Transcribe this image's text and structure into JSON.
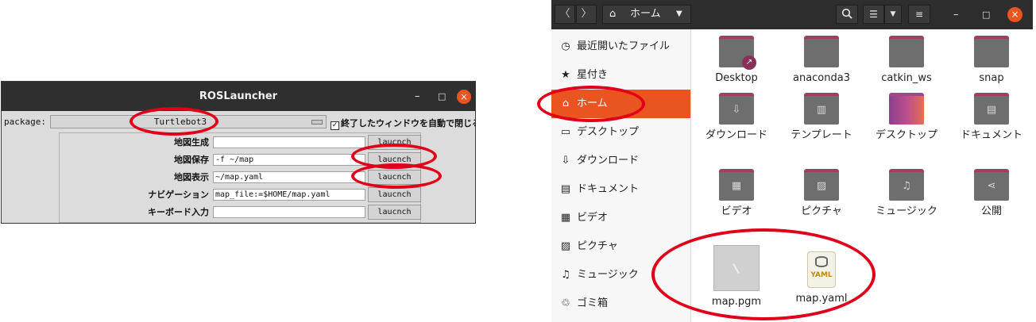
{
  "ros_launcher": {
    "title": "ROSLauncher",
    "minimize": "–",
    "maximize": "□",
    "close": "×",
    "package_label": "package:",
    "package_value": "Turtlebot3",
    "checkbox_mark": "✓",
    "checkbox_label": "終了したウィンドウを自動で閉じる",
    "rows": [
      {
        "label": "地図生成",
        "value": "",
        "button": "laucnch"
      },
      {
        "label": "地図保存",
        "value": "-f ~/map",
        "button": "laucnch"
      },
      {
        "label": "地図表示",
        "value": "~/map.yaml",
        "button": "laucnch"
      },
      {
        "label": "ナビゲーション",
        "value": "map_file:=$HOME/map.yaml",
        "button": "laucnch"
      },
      {
        "label": "キーボード入力",
        "value": "",
        "button": "laucnch"
      }
    ]
  },
  "file_manager": {
    "back": "〈",
    "forward": "〉",
    "location": "ホーム",
    "search_icon": "search-icon",
    "close": "×",
    "minimize": "–",
    "maximize": "□",
    "sidebar": [
      {
        "icon": "recent-icon",
        "glyph": "◷",
        "label": "最近開いたファイル"
      },
      {
        "icon": "star-icon",
        "glyph": "★",
        "label": "星付き"
      },
      {
        "icon": "home-icon",
        "glyph": "⌂",
        "label": "ホーム"
      },
      {
        "icon": "desktop-icon",
        "glyph": "▭",
        "label": "デスクトップ"
      },
      {
        "icon": "download-icon",
        "glyph": "⇩",
        "label": "ダウンロード"
      },
      {
        "icon": "document-icon",
        "glyph": "▤",
        "label": "ドキュメント"
      },
      {
        "icon": "video-icon",
        "glyph": "▦",
        "label": "ビデオ"
      },
      {
        "icon": "picture-icon",
        "glyph": "▨",
        "label": "ピクチャ"
      },
      {
        "icon": "music-icon",
        "glyph": "♫",
        "label": "ミュージック"
      },
      {
        "icon": "trash-icon",
        "glyph": "♲",
        "label": "ゴミ箱"
      }
    ],
    "files": [
      {
        "name": "Desktop",
        "type": "folder",
        "emblem": "",
        "badge": "↗"
      },
      {
        "name": "anaconda3",
        "type": "folder",
        "emblem": ""
      },
      {
        "name": "catkin_ws",
        "type": "folder",
        "emblem": ""
      },
      {
        "name": "snap",
        "type": "folder",
        "emblem": ""
      },
      {
        "name": "ダウンロード",
        "type": "folder",
        "emblem": "⇩"
      },
      {
        "name": "テンプレート",
        "type": "folder",
        "emblem": "▥"
      },
      {
        "name": "デスクトップ",
        "type": "folder-desktop",
        "emblem": ""
      },
      {
        "name": "ドキュメント",
        "type": "folder",
        "emblem": "▤"
      },
      {
        "name": "ビデオ",
        "type": "folder",
        "emblem": "▦"
      },
      {
        "name": "ピクチャ",
        "type": "folder",
        "emblem": "▨"
      },
      {
        "name": "ミュージック",
        "type": "folder",
        "emblem": "♫"
      },
      {
        "name": "公開",
        "type": "folder",
        "emblem": "⋖"
      },
      {
        "name": "map.pgm",
        "type": "image"
      },
      {
        "name": "map.yaml",
        "type": "yaml",
        "file_label": "YAML"
      }
    ]
  },
  "colors": {
    "accent": "#e95420",
    "annotation": "#e0001a"
  }
}
